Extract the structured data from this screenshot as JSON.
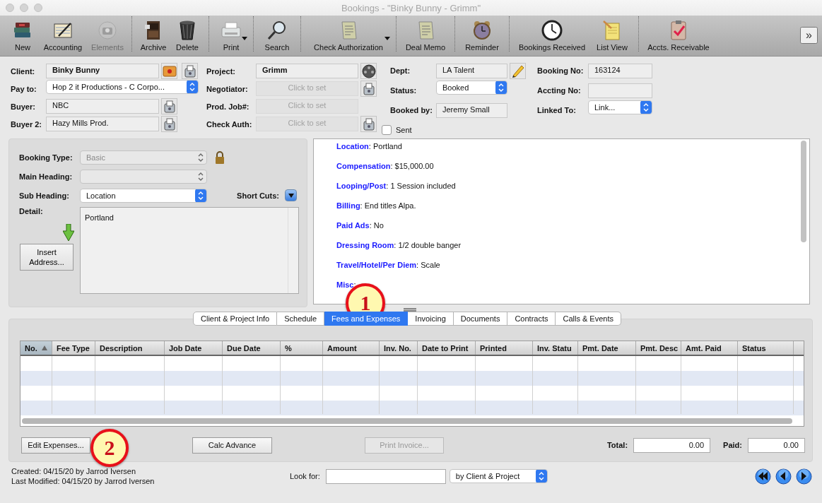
{
  "window": {
    "title": "Bookings - \"Binky Bunny - Grimm\""
  },
  "toolbar": {
    "groups": [
      [
        {
          "label": "New",
          "disabled": false,
          "menu": false
        },
        {
          "label": "Accounting",
          "disabled": false,
          "menu": false
        },
        {
          "label": "Elements",
          "disabled": true,
          "menu": false
        }
      ],
      [
        {
          "label": "Archive",
          "disabled": false,
          "menu": false
        },
        {
          "label": "Delete",
          "disabled": false,
          "menu": false
        }
      ],
      [
        {
          "label": "Print",
          "disabled": false,
          "menu": true
        }
      ],
      [
        {
          "label": "Search",
          "disabled": false,
          "menu": false
        }
      ],
      [
        {
          "label": "Check Authorization",
          "disabled": false,
          "menu": true
        }
      ],
      [
        {
          "label": "Deal Memo",
          "disabled": false,
          "menu": false
        }
      ],
      [
        {
          "label": "Reminder",
          "disabled": false,
          "menu": false
        }
      ],
      [
        {
          "label": "Bookings Received",
          "disabled": false,
          "menu": false
        },
        {
          "label": "List View",
          "disabled": false,
          "menu": false
        }
      ],
      [
        {
          "label": "Accts. Receivable",
          "disabled": false,
          "menu": false
        }
      ]
    ],
    "overflow": "»"
  },
  "form": {
    "columns": [
      {
        "fields": [
          {
            "label": "Client:",
            "kind": "text",
            "value": "Binky Bunny",
            "bold": true
          },
          {
            "label": "Pay to:",
            "kind": "popup",
            "value": "Hop 2 it Productions - C Corpo...",
            "bold": false
          },
          {
            "label": "Buyer:",
            "kind": "text",
            "value": "NBC",
            "bold": false
          },
          {
            "label": "Buyer 2:",
            "kind": "text",
            "value": "Hazy Mills Prod.",
            "bold": false
          }
        ]
      },
      {
        "fields": [
          {
            "label": "Project:",
            "kind": "text",
            "value": "Grimm",
            "bold": true
          },
          {
            "label": "Negotiator:",
            "kind": "link",
            "placeholder": "Click to set"
          },
          {
            "label": "Prod. Job#:",
            "kind": "link",
            "placeholder": "Click to set"
          },
          {
            "label": "Check Auth:",
            "kind": "link",
            "placeholder": "Click to set"
          }
        ]
      },
      {
        "fields": [
          {
            "label": "Dept:",
            "kind": "text",
            "value": "LA Talent",
            "bold": false
          },
          {
            "label": "Status:",
            "kind": "popup",
            "value": "Booked",
            "bold": false
          },
          {
            "label": "Booked by:",
            "kind": "text",
            "value": "Jeremy Small",
            "bold": false
          },
          {
            "label": "Sent",
            "kind": "checkbox",
            "checked": false
          }
        ]
      },
      {
        "fields": [
          {
            "label": "Booking No:",
            "kind": "text",
            "value": "163124",
            "bold": false
          },
          {
            "label": "Accting No:",
            "kind": "text"
          },
          {
            "label": "Linked To:",
            "kind": "popup",
            "value": "Link...",
            "bold": false
          }
        ]
      }
    ]
  },
  "heading_panel": {
    "selects": [
      {
        "label": "Booking Type:",
        "value": "Basic",
        "disabled": true
      },
      {
        "label": "Main Heading:",
        "disabled": true
      },
      {
        "label": "Sub Heading:",
        "value": "Location",
        "disabled": false
      }
    ],
    "short_cuts": {
      "label": "Short Cuts:"
    },
    "detail": {
      "label": "Detail:",
      "value": "Portland"
    },
    "insert_button": "Insert Address..."
  },
  "terms": [
    {
      "label": "Location",
      "value": ": Portland"
    },
    {
      "label": "Compensation",
      "value": ": $15,000.00"
    },
    {
      "label": "Looping/Post",
      "value": ": 1 Session included"
    },
    {
      "label": "Billing",
      "value": ": End titles Alpa."
    },
    {
      "label": "Paid Ads",
      "value": ": No"
    },
    {
      "label": "Dressing Room",
      "value": ": 1/2 double banger"
    },
    {
      "label": "Travel/Hotel/Per Diem",
      "value": ": Scale"
    },
    {
      "label": "Misc",
      "value": ":"
    }
  ],
  "tabs": [
    {
      "label": "Client & Project Info",
      "selected": false
    },
    {
      "label": "Schedule",
      "selected": false
    },
    {
      "label": "Fees and Expenses",
      "selected": true
    },
    {
      "label": "Invoicing",
      "selected": false
    },
    {
      "label": "Documents",
      "selected": false
    },
    {
      "label": "Contracts",
      "selected": false
    },
    {
      "label": "Calls & Events",
      "selected": false
    }
  ],
  "fees_table": {
    "columns": [
      {
        "label": "No.",
        "sorted": true
      },
      {
        "label": "Fee Type",
        "sorted": false
      },
      {
        "label": "Description",
        "sorted": false
      },
      {
        "label": "Job Date",
        "sorted": false
      },
      {
        "label": "Due Date",
        "sorted": false
      },
      {
        "label": "%",
        "sorted": false
      },
      {
        "label": "Amount",
        "sorted": false
      },
      {
        "label": "Inv. No.",
        "sorted": false
      },
      {
        "label": "Date to Print",
        "sorted": false
      },
      {
        "label": "Printed",
        "sorted": false
      },
      {
        "label": "Inv. Statu",
        "sorted": false
      },
      {
        "label": "Pmt. Date",
        "sorted": false
      },
      {
        "label": "Pmt. Desc",
        "sorted": false
      },
      {
        "label": "Amt. Paid",
        "sorted": false
      },
      {
        "label": "Status",
        "sorted": false
      }
    ]
  },
  "actions": [
    {
      "label": "Edit Expenses...",
      "disabled": false
    },
    {
      "label": "Calc Advance",
      "disabled": false
    },
    {
      "label": "Print Invoice...",
      "disabled": true
    }
  ],
  "totals": [
    {
      "label": "Total:",
      "value": "0.00"
    },
    {
      "label": "Paid:",
      "value": "0.00"
    }
  ],
  "footer": {
    "created": "Created: 04/15/20 by Jarrod Iversen",
    "modified": "Last Modified: 04/15/20 by Jarrod Iversen",
    "search": {
      "label": "Look for:",
      "mode": "by Client & Project"
    }
  },
  "callouts": [
    {
      "number": "1"
    },
    {
      "number": "2"
    }
  ]
}
